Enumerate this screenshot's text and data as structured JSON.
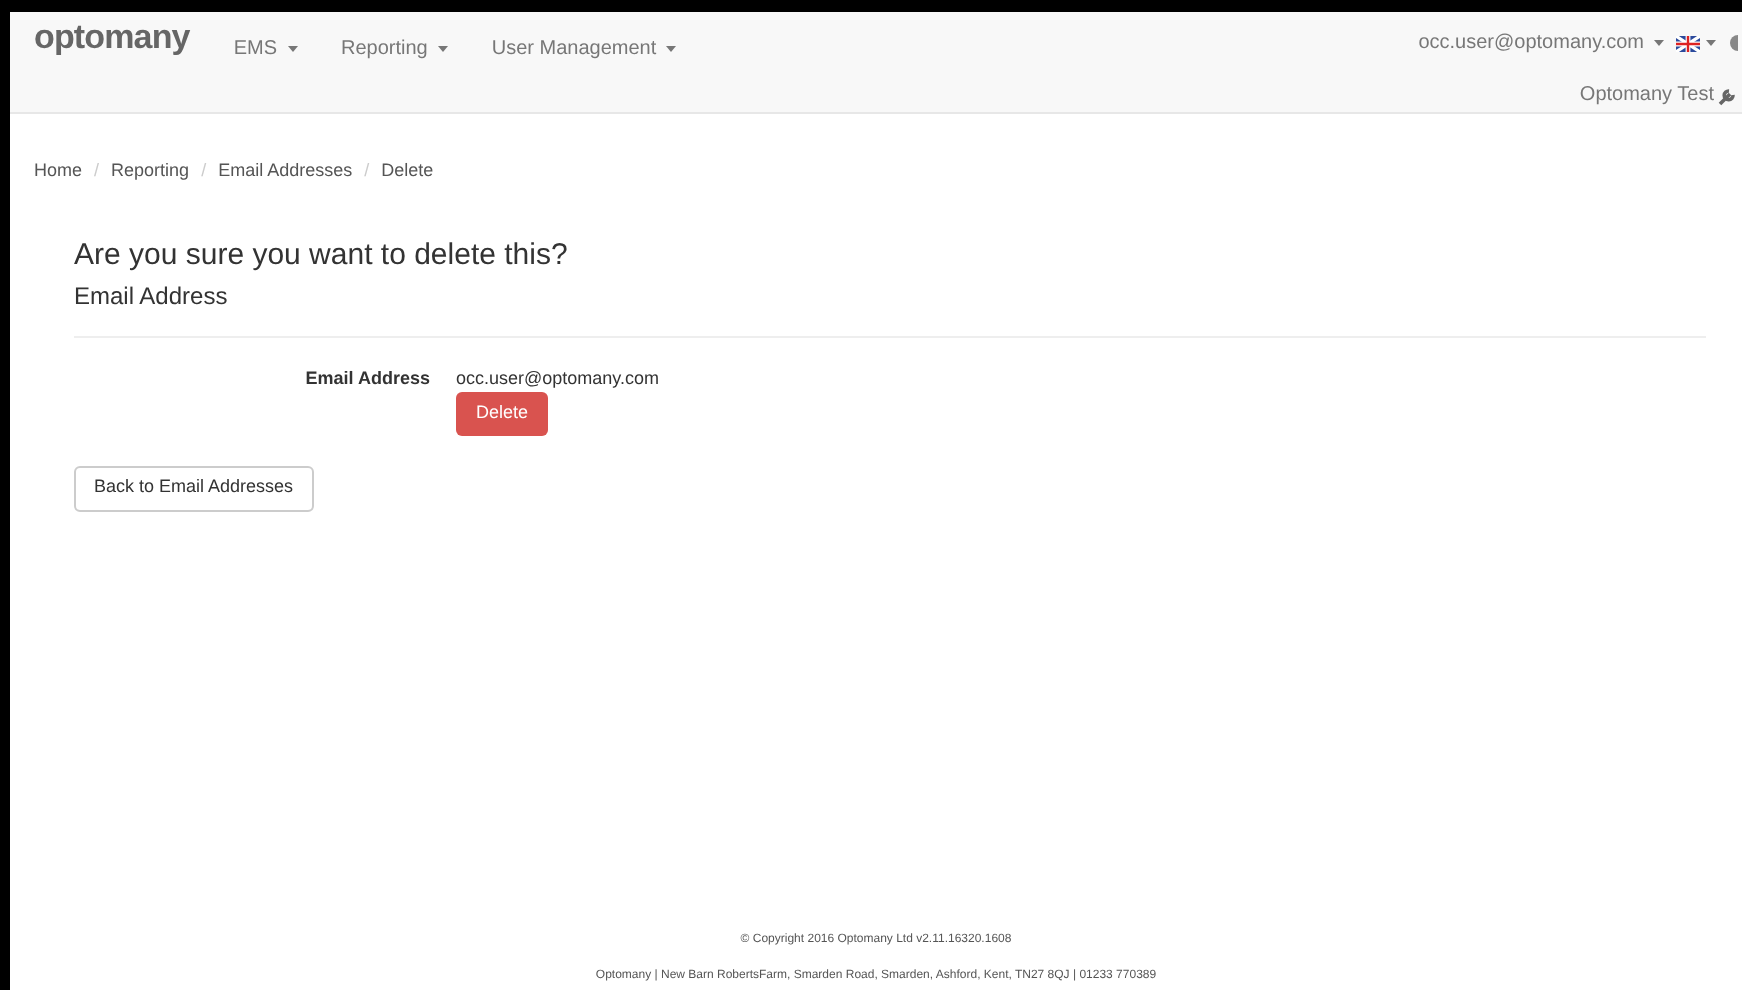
{
  "navbar": {
    "brand": "optomany",
    "menus": [
      {
        "label": "EMS"
      },
      {
        "label": "Reporting"
      },
      {
        "label": "User Management"
      }
    ],
    "user": "occ.user@optomany.com",
    "account": "Optomany Test"
  },
  "breadcrumb": [
    "Home",
    "Reporting",
    "Email Addresses",
    "Delete"
  ],
  "breadcrumb_separator": "/",
  "heading": "Are you sure you want to delete this?",
  "subheading": "Email Address",
  "fields": [
    {
      "label": "Email Address",
      "value": "occ.user@optomany.com"
    }
  ],
  "delete_button": "Delete",
  "back_button": "Back to Email Addresses",
  "footer": [
    "© Copyright 2016 Optomany Ltd v2.11.16320.1608",
    "Optomany | New Barn RobertsFarm, Smarden Road, Smarden, Ashford, Kent, TN27 8QJ | 01233 770389"
  ]
}
